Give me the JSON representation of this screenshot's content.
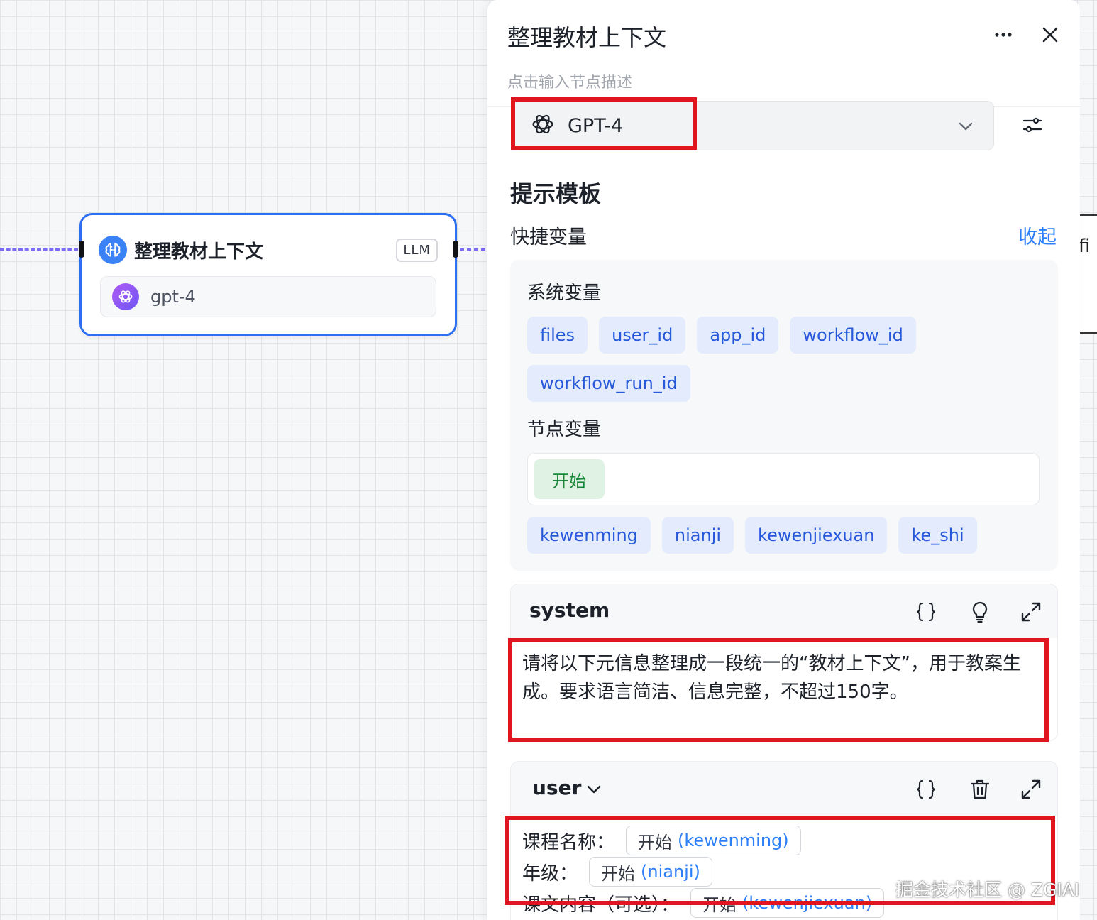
{
  "canvas": {
    "node": {
      "title": "整理教材上下文",
      "badge": "LLM",
      "model": "gpt-4"
    },
    "peek_text": "fi"
  },
  "panel": {
    "title": "整理教材上下文",
    "description_placeholder": "点击输入节点描述",
    "model_selected": "GPT-4",
    "prompt_section_title": "提示模板",
    "shortcut_vars": {
      "title": "快捷变量",
      "collapse_label": "收起",
      "system_vars_label": "系统变量",
      "system_vars": [
        "files",
        "user_id",
        "app_id",
        "workflow_id",
        "workflow_run_id"
      ],
      "node_vars_label": "节点变量",
      "node_source": "开始",
      "node_vars": [
        "kewenming",
        "nianji",
        "kewenjiexuan",
        "ke_shi"
      ]
    },
    "system_message": {
      "role": "system",
      "text": "请将以下元信息整理成一段统一的“教材上下文”，用于教案生成。要求语言简洁、信息完整，不超过150字。"
    },
    "user_message": {
      "role": "user",
      "lines": [
        {
          "label": "课程名称：",
          "source": "开始",
          "var": "(kewenming)"
        },
        {
          "label": "年级：",
          "source": "开始",
          "var": "(nianji)"
        },
        {
          "label": "课文内容（可选）：",
          "source": "开始",
          "var": "(kewenjiexuan)"
        }
      ]
    }
  },
  "watermark": "掘金技术社区 @ ZGIAI",
  "colors": {
    "accent": "#2e6ff2",
    "link": "#2d7ff9",
    "chip_bg": "#e3ebfd",
    "chip_text": "#2658d9",
    "start_bg": "#dff2e3",
    "start_text": "#1a8a3a",
    "annotation_red": "#e0151f",
    "edge": "#7b6cf6"
  },
  "icons": [
    "brain-icon",
    "openai-icon",
    "more-icon",
    "close-icon",
    "chevron-down-icon",
    "settings-sliders-icon",
    "braces-icon",
    "lightbulb-icon",
    "expand-icon",
    "trash-icon"
  ]
}
